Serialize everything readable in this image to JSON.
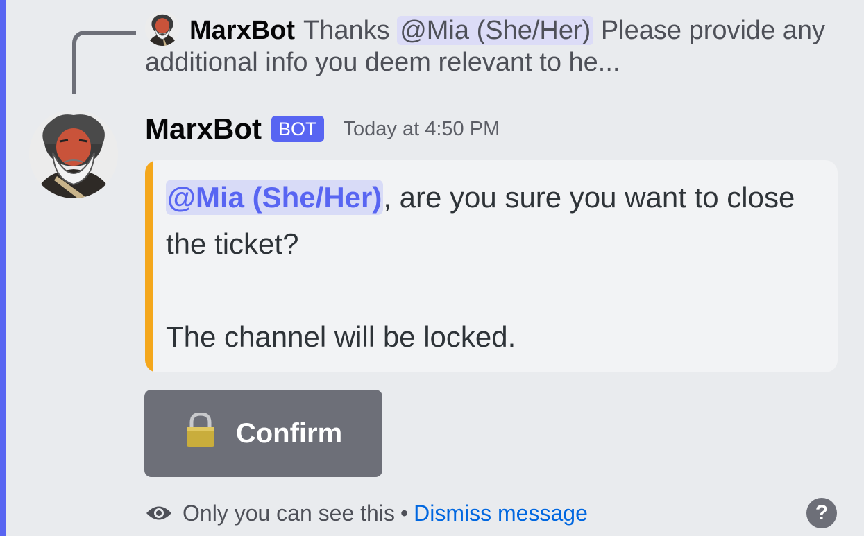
{
  "reply": {
    "author": "MarxBot",
    "text_before": "Thanks ",
    "mention": "@Mia (She/Her)",
    "text_after": "  Please provide any additional info you deem relevant to he..."
  },
  "message": {
    "author": "MarxBot",
    "bot_tag": "BOT",
    "timestamp": "Today at 4:50 PM",
    "embed": {
      "mention": "@Mia (She/Her)",
      "line1": ", are you sure you want to close the ticket?",
      "line2": "The channel will be locked.",
      "accent_color": "#f4a71c"
    },
    "button": {
      "label": "Confirm",
      "icon": "lock-icon"
    }
  },
  "footer": {
    "visibility_text": "Only you can see this",
    "separator": "•",
    "dismiss_label": "Dismiss message",
    "help": "?"
  },
  "colors": {
    "blurple": "#5865f2",
    "link": "#0067e0",
    "button": "#6d6f78",
    "background": "#e9ebee"
  }
}
